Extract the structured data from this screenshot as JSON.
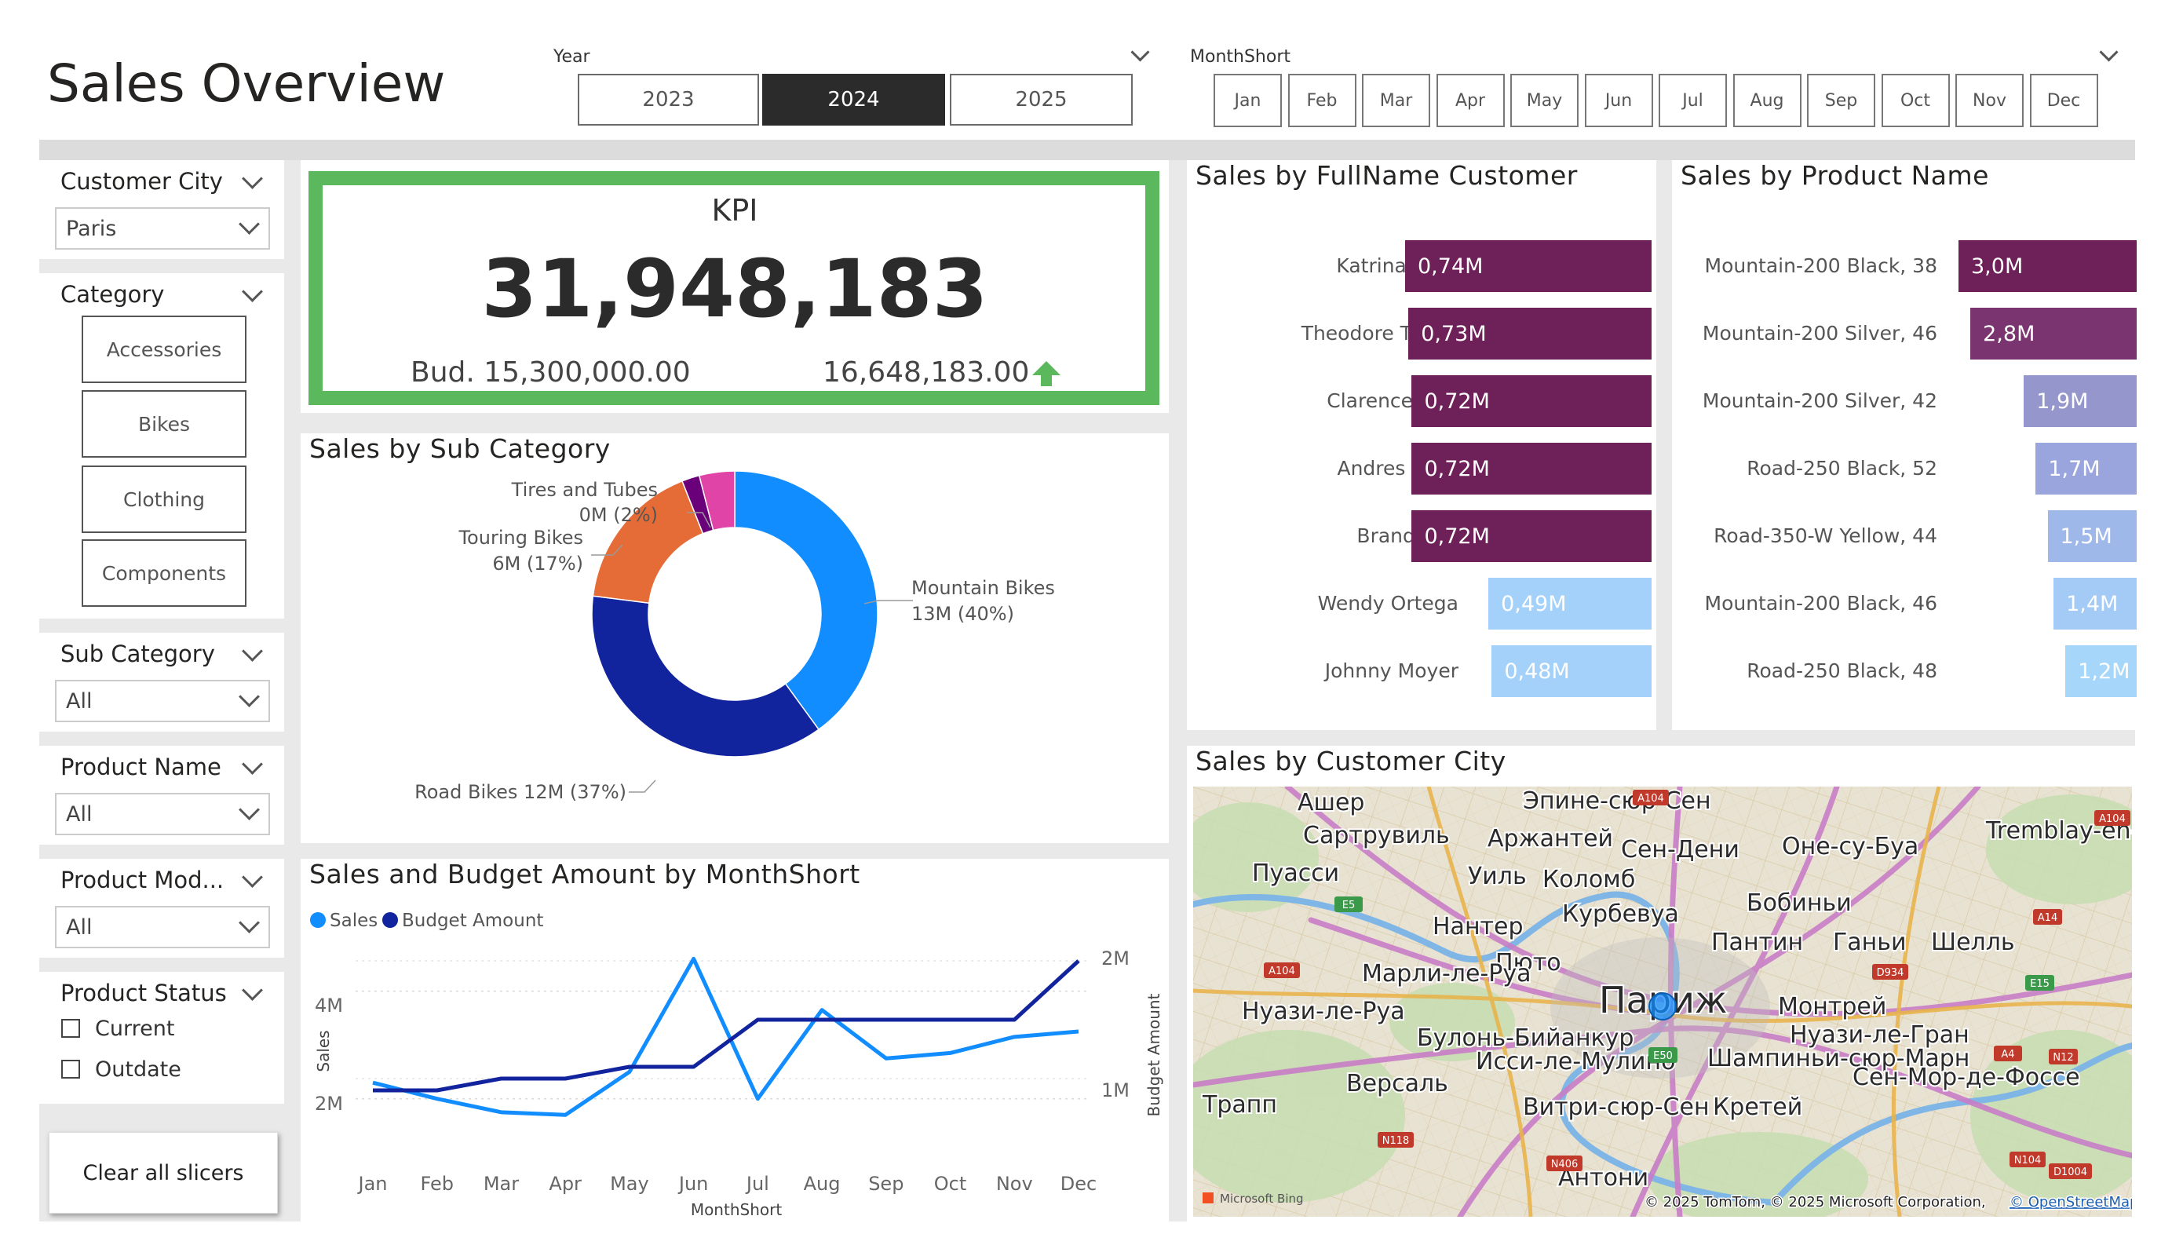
{
  "page": {
    "title": "Sales Overview"
  },
  "year_slicer": {
    "label": "Year",
    "options": [
      "2023",
      "2024",
      "2025"
    ],
    "selected": "2024"
  },
  "month_slicer": {
    "label": "MonthShort",
    "options": [
      "Jan",
      "Feb",
      "Mar",
      "Apr",
      "May",
      "Jun",
      "Jul",
      "Aug",
      "Sep",
      "Oct",
      "Nov",
      "Dec"
    ]
  },
  "filters": {
    "customer_city": {
      "label": "Customer City",
      "value": "Paris"
    },
    "category": {
      "label": "Category",
      "options": [
        "Accessories",
        "Bikes",
        "Clothing",
        "Components"
      ]
    },
    "sub_category": {
      "label": "Sub Category",
      "value": "All"
    },
    "product_name": {
      "label": "Product Name",
      "value": "All"
    },
    "product_model": {
      "label": "Product Mod...",
      "value": "All"
    },
    "product_status": {
      "label": "Product Status",
      "options": [
        "Current",
        "Outdate"
      ]
    },
    "clear_button": "Clear all slicers"
  },
  "kpi": {
    "title": "KPI",
    "value": "31,948,183",
    "budget": "Bud. 15,300,000.00",
    "delta": "16,648,183.00",
    "border_color": "#5cb85c",
    "arrow_color": "#5cb85c"
  },
  "sub_category_chart": {
    "title": "Sales by Sub Category",
    "labels": {
      "tires_a": "Tires and Tubes",
      "tires_b": "0M (2%)",
      "touring_a": "Touring Bikes",
      "touring_b": "6M (17%)",
      "mountain_a": "Mountain Bikes",
      "mountain_b": "13M (40%)",
      "road": "Road Bikes 12M (37%)"
    }
  },
  "line_chart": {
    "title": "Sales and Budget Amount by MonthShort",
    "legend": [
      "Sales",
      "Budget Amount"
    ],
    "y_left_label": "Sales",
    "y_right_label": "Budget Amount",
    "x_label": "MonthShort",
    "y_left_ticks": [
      "4M",
      "2M"
    ],
    "y_right_ticks": [
      "2M",
      "1M"
    ]
  },
  "customer_chart": {
    "title": "Sales by FullName Customer"
  },
  "product_chart": {
    "title": "Sales by Product Name"
  },
  "map": {
    "title": "Sales by Customer City",
    "attribution": "© 2025 TomTom, © 2025 Microsoft Corporation,",
    "osm": "© OpenStreetMap",
    "bing": "Microsoft Bing",
    "labels": [
      {
        "t": "Ашер"
      },
      {
        "t": "Эпине-сюр-Сен"
      },
      {
        "t": "Сартрувиль"
      },
      {
        "t": "Аржантей"
      },
      {
        "t": "Сен-Дени"
      },
      {
        "t": "Оне-су-Буа"
      },
      {
        "t": "Tremblay-en-Fran"
      },
      {
        "t": "Пуасси"
      },
      {
        "t": "Уиль"
      },
      {
        "t": "Коломб"
      },
      {
        "t": "Бобиньи"
      },
      {
        "t": "Курбевуа"
      },
      {
        "t": "Нантер"
      },
      {
        "t": "Пантин"
      },
      {
        "t": "Ганьи"
      },
      {
        "t": "Шелль"
      },
      {
        "t": "Пюто"
      },
      {
        "t": "Марли-ле-Руа"
      },
      {
        "t": "Париж"
      },
      {
        "t": "Монтрей"
      },
      {
        "t": "Нуази-ле-Руа"
      },
      {
        "t": "Булонь-Бийанкур"
      },
      {
        "t": "Нуази-ле-Гран"
      },
      {
        "t": "Исси-ле-Мулино"
      },
      {
        "t": "Шампиньи-сюр-Марн"
      },
      {
        "t": "Версаль"
      },
      {
        "t": "Сен-Мор-де-Фоссе"
      },
      {
        "t": "Трапп"
      },
      {
        "t": "Витри-сюр-Сен"
      },
      {
        "t": "Кретей"
      },
      {
        "t": "Антони"
      }
    ],
    "road_shields": [
      "A104",
      "A104",
      "A14",
      "E5",
      "A104",
      "D934",
      "E15",
      "E50",
      "A4",
      "N12",
      "N118",
      "N406",
      "N104",
      "D1004"
    ]
  },
  "chart_data": [
    {
      "type": "pie",
      "title": "Sales by Sub Category",
      "categories": [
        "Mountain Bikes",
        "Road Bikes",
        "Touring Bikes",
        "Tires and Tubes",
        "Other"
      ],
      "values": [
        40,
        37,
        17,
        2,
        4
      ],
      "display_values": [
        "13M (40%)",
        "12M (37%)",
        "6M (17%)",
        "0M (2%)",
        ""
      ],
      "colors": [
        "#118dff",
        "#12239e",
        "#e66c37",
        "#6b007b",
        "#e044a7"
      ]
    },
    {
      "type": "line",
      "title": "Sales and Budget Amount by MonthShort",
      "categories": [
        "Jan",
        "Feb",
        "Mar",
        "Apr",
        "May",
        "Jun",
        "Jul",
        "Aug",
        "Sep",
        "Oct",
        "Nov",
        "Dec"
      ],
      "series": [
        {
          "name": "Sales",
          "axis": "left",
          "color": "#118dff",
          "values": [
            2.3,
            2.0,
            1.75,
            1.7,
            2.5,
            4.6,
            2.0,
            3.65,
            2.75,
            2.85,
            3.15,
            3.25
          ]
        },
        {
          "name": "Budget Amount",
          "axis": "right",
          "color": "#12239e",
          "values": [
            0.9,
            0.9,
            1.0,
            1.0,
            1.1,
            1.1,
            1.5,
            1.5,
            1.5,
            1.5,
            1.5,
            2.0
          ]
        }
      ],
      "y_left_range": [
        1.5,
        5.0
      ],
      "y_right_range": [
        0.6,
        2.2
      ],
      "xlabel": "MonthShort",
      "ylabel": "Sales",
      "y2label": "Budget Amount"
    },
    {
      "type": "bar",
      "title": "Sales by FullName Customer",
      "categories": [
        "Katrina Tang",
        "Theodore Torres",
        "Clarence Gao",
        "Andres Nara",
        "Brandi Gill",
        "Wendy Ortega",
        "Johnny Moyer"
      ],
      "values": [
        0.74,
        0.73,
        0.72,
        0.72,
        0.72,
        0.49,
        0.48
      ],
      "display_values": [
        "0,74M",
        "0,73M",
        "0,72M",
        "0,72M",
        "0,72M",
        "0,49M",
        "0,48M"
      ],
      "colors": [
        "#6e2058",
        "#6e2058",
        "#6e2058",
        "#6e2058",
        "#6e2058",
        "#a3d1f9",
        "#a3d1f9"
      ],
      "max": 0.74
    },
    {
      "type": "bar",
      "title": "Sales by Product Name",
      "categories": [
        "Mountain-200 Black, 38",
        "Mountain-200 Silver, 46",
        "Mountain-200 Silver, 42",
        "Road-250 Black, 52",
        "Road-350-W Yellow, 44",
        "Mountain-200 Black, 46",
        "Road-250 Black, 48"
      ],
      "values": [
        3.0,
        2.8,
        1.9,
        1.7,
        1.5,
        1.4,
        1.2
      ],
      "display_values": [
        "3,0M",
        "2,8M",
        "1,9M",
        "1,7M",
        "1,5M",
        "1,4M",
        "1,2M"
      ],
      "colors": [
        "#6e2058",
        "#7a3570",
        "#9597cc",
        "#99a5dc",
        "#9fb8ea",
        "#a3cbf5",
        "#a6d7fb"
      ],
      "max": 3.0
    }
  ]
}
